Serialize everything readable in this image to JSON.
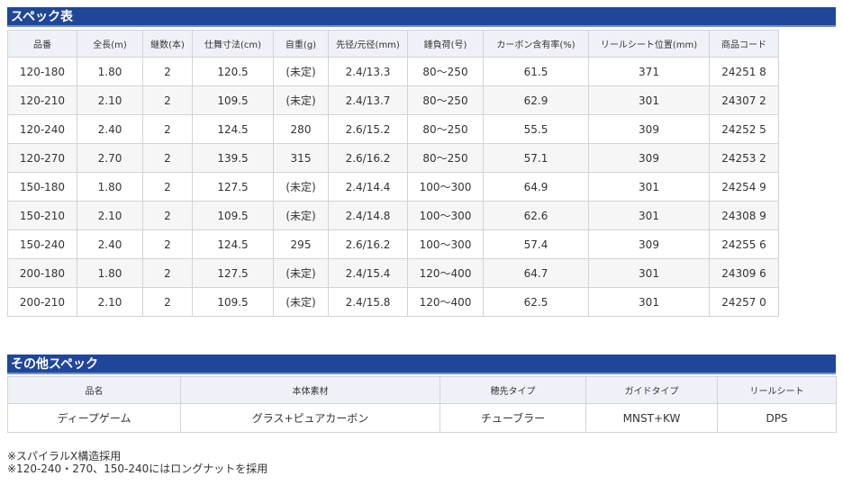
{
  "spec_section": {
    "title": "スペック表",
    "headers": [
      "品番",
      "全長(m)",
      "継数(本)",
      "仕舞寸法(cm)",
      "自重(g)",
      "先径/元径(mm)",
      "錘負荷(号)",
      "カーボン含有率(%)",
      "リールシート位置(mm)",
      "商品コード"
    ],
    "rows": [
      [
        "120-180",
        "1.80",
        "2",
        "120.5",
        "(未定)",
        "2.4/13.3",
        "80〜250",
        "61.5",
        "371",
        "24251 8"
      ],
      [
        "120-210",
        "2.10",
        "2",
        "109.5",
        "(未定)",
        "2.4/13.7",
        "80〜250",
        "62.9",
        "301",
        "24307 2"
      ],
      [
        "120-240",
        "2.40",
        "2",
        "124.5",
        "280",
        "2.6/15.2",
        "80〜250",
        "55.5",
        "309",
        "24252 5"
      ],
      [
        "120-270",
        "2.70",
        "2",
        "139.5",
        "315",
        "2.6/16.2",
        "80〜250",
        "57.1",
        "309",
        "24253 2"
      ],
      [
        "150-180",
        "1.80",
        "2",
        "127.5",
        "(未定)",
        "2.4/14.4",
        "100〜300",
        "64.9",
        "301",
        "24254 9"
      ],
      [
        "150-210",
        "2.10",
        "2",
        "109.5",
        "(未定)",
        "2.4/14.8",
        "100〜300",
        "62.6",
        "301",
        "24308 9"
      ],
      [
        "150-240",
        "2.40",
        "2",
        "124.5",
        "295",
        "2.6/16.2",
        "100〜300",
        "57.4",
        "309",
        "24255 6"
      ],
      [
        "200-180",
        "1.80",
        "2",
        "127.5",
        "(未定)",
        "2.4/15.4",
        "120〜400",
        "64.7",
        "301",
        "24309 6"
      ],
      [
        "200-210",
        "2.10",
        "2",
        "109.5",
        "(未定)",
        "2.4/15.8",
        "120〜400",
        "62.5",
        "301",
        "24257 0"
      ]
    ]
  },
  "other_section": {
    "title": "その他スペック",
    "headers": [
      "品名",
      "本体素材",
      "穂先タイプ",
      "ガイドタイプ",
      "リールシート"
    ],
    "row": [
      "ディープゲーム",
      "グラス+ピュアカーボン",
      "チューブラー",
      "MNST+KW",
      "DPS"
    ]
  },
  "notes": [
    "※スパイラルX構造採用",
    "※120-240・270、150-240にはロングナットを採用"
  ],
  "colors": {
    "section_bar": "#1f4699",
    "header_bg": "#eef2f8",
    "alt_row_bg": "#f6f6f6",
    "border": "#d3d3d3"
  }
}
